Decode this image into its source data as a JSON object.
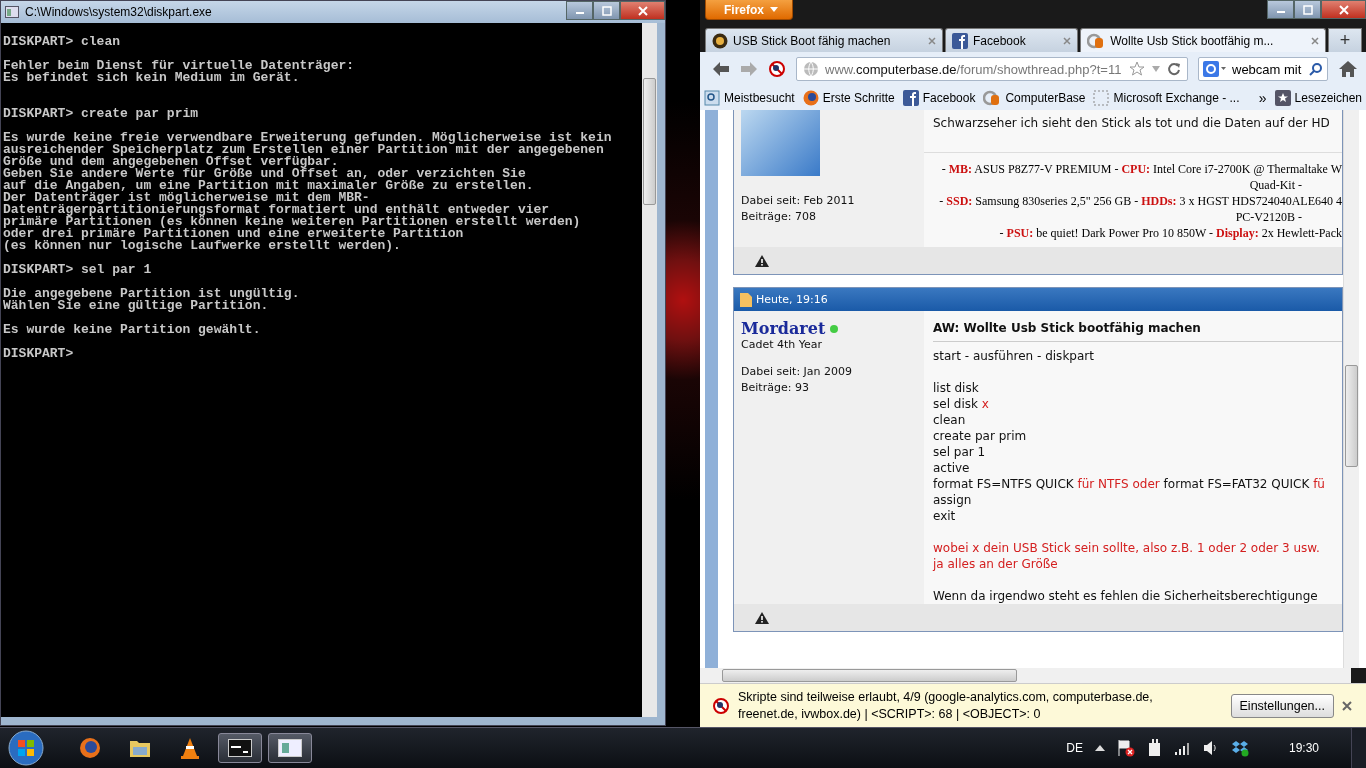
{
  "console": {
    "title": "C:\\Windows\\system32\\diskpart.exe",
    "text": "DISKPART> clean\n\nFehler beim Dienst für virtuelle Datenträger:\nEs befindet sich kein Medium im Gerät.\n\n\nDISKPART> create par prim\n\nEs wurde keine freie verwendbare Erweiterung gefunden. Möglicherweise ist kein\nausreichender Speicherplatz zum Erstellen einer Partition mit der angegebenen\nGröße und dem angegebenen Offset verfügbar.\nGeben Sie andere Werte für Größe und Offset an, oder verzichten Sie\nauf die Angaben, um eine Partition mit maximaler Größe zu erstellen.\nDer Datenträger ist möglicherweise mit dem MBR-\nDatenträgerpartitionierungsformat formatiert und enthält entweder vier\nprimäre Partitionen (es können keine weiteren Partitionen erstellt werden)\noder drei primäre Partitionen und eine erweiterte Partition\n(es können nur logische Laufwerke erstellt werden).\n\nDISKPART> sel par 1\n\nDie angegebene Partition ist ungültig.\nWählen Sie eine gültige Partition.\n\nEs wurde keine Partition gewählt.\n\nDISKPART>"
  },
  "browser": {
    "menu_button": "Firefox",
    "tabs": [
      {
        "label": "USB Stick Boot fähig machen",
        "kind": "forum",
        "selected": false
      },
      {
        "label": "Facebook",
        "kind": "facebook",
        "selected": false
      },
      {
        "label": "Wollte Usb Stick bootfähig m...",
        "kind": "computerbase",
        "selected": true
      }
    ],
    "new_tab": "+",
    "url": {
      "prefix": "www.",
      "domain": "computerbase.de",
      "path": "/forum/showthread.php?t=11"
    },
    "search": {
      "value": "webcam mit"
    },
    "bookmarks": [
      {
        "label": "Meistbesucht",
        "kind": "history"
      },
      {
        "label": "Erste Schritte",
        "kind": "firefox"
      },
      {
        "label": "Facebook",
        "kind": "facebook"
      },
      {
        "label": "ComputerBase",
        "kind": "computerbase"
      },
      {
        "label": "Microsoft Exchange - ...",
        "kind": "page"
      }
    ],
    "bookmarks_more": "»",
    "bookmarks_menu": "Lesezeichen",
    "posts": [
      {
        "kind": "partial",
        "member_since": "Dabei seit: Feb 2011",
        "post_count": "Beiträge: 708",
        "text": "Schwarzseher ich sieht den Stick als tot und die Daten auf der HD",
        "signature": [
          [
            {
              "text": "- ",
              "emphasized": false
            },
            {
              "text": "MB:",
              "emphasized": true
            },
            {
              "text": " ASUS P8Z77-V PREMIUM - ",
              "emphasized": false
            },
            {
              "text": "CPU:",
              "emphasized": true
            },
            {
              "text": " Intel Core i7-2700K @ Thermaltake W",
              "emphasized": false
            }
          ],
          [
            {
              "text": "Quad-Kit -",
              "emphasized": false
            }
          ],
          [
            {
              "text": "- ",
              "emphasized": false
            },
            {
              "text": "SSD:",
              "emphasized": true
            },
            {
              "text": " Samsung 830series 2,5\" 256 GB - ",
              "emphasized": false
            },
            {
              "text": "HDDs:",
              "emphasized": true
            },
            {
              "text": " 3 x HGST HDS724040ALE640 4",
              "emphasized": false
            }
          ],
          [
            {
              "text": "PC-V2120B -",
              "emphasized": false
            }
          ],
          [
            {
              "text": "- ",
              "emphasized": false
            },
            {
              "text": "PSU:",
              "emphasized": true
            },
            {
              "text": " be quiet! Dark Power Pro 10 850W - ",
              "emphasized": false
            },
            {
              "text": "Display:",
              "emphasized": true
            },
            {
              "text": " 2x Hewlett-Pack",
              "emphasized": false
            }
          ]
        ]
      },
      {
        "kind": "full",
        "date": "Heute, 19:16",
        "username": "Mordaret",
        "online": true,
        "rank": "Cadet 4th Year",
        "member_since": "Dabei seit: Jan 2009",
        "post_count": "Beiträge: 93",
        "title": "AW: Wollte Usb Stick bootfähig machen",
        "paragraphs": [
          [
            [
              {
                "text": "start - ausführen - diskpart",
                "emphasized": false
              }
            ]
          ],
          [
            [
              {
                "text": "list disk",
                "emphasized": false
              }
            ],
            [
              {
                "text": "sel disk ",
                "emphasized": false
              },
              {
                "text": "x",
                "emphasized": true
              }
            ],
            [
              {
                "text": "clean",
                "emphasized": false
              }
            ],
            [
              {
                "text": "create par prim",
                "emphasized": false
              }
            ],
            [
              {
                "text": "sel par 1",
                "emphasized": false
              }
            ],
            [
              {
                "text": "active",
                "emphasized": false
              }
            ],
            [
              {
                "text": "format FS=NTFS QUICK ",
                "emphasized": false
              },
              {
                "text": "für NTFS oder",
                "emphasized": true
              },
              {
                "text": " format FS=FAT32 QUICK ",
                "emphasized": false
              },
              {
                "text": "fü",
                "emphasized": true
              }
            ],
            [
              {
                "text": "assign",
                "emphasized": false
              }
            ],
            [
              {
                "text": "exit",
                "emphasized": false
              }
            ]
          ],
          [
            [
              {
                "text": "wobei x dein USB Stick sein sollte, also z.B. 1 oder 2 oder 3 usw.",
                "emphasized": true
              }
            ],
            [
              {
                "text": "ja alles an der Größe",
                "emphasized": true
              }
            ]
          ],
          [
            [
              {
                "text": "Wenn da irgendwo steht es fehlen die Sicherheitsberechtigunge",
                "emphasized": false
              }
            ]
          ]
        ]
      }
    ],
    "notification": {
      "text": "Skripte sind teilweise erlaubt, 4/9 (google-analytics.com, computerbase.de, freenet.de, ivwbox.de) | <SCRIPT>: 68 | <OBJECT>: 0",
      "button": "Einstellungen..."
    }
  },
  "taskbar": {
    "apps": [
      {
        "kind": "firefox",
        "selected": false
      },
      {
        "kind": "folder",
        "selected": false
      },
      {
        "kind": "cone",
        "selected": false
      },
      {
        "kind": "console",
        "selected": true
      },
      {
        "kind": "window",
        "selected": true
      }
    ],
    "language": "DE",
    "clock": "19:30"
  }
}
